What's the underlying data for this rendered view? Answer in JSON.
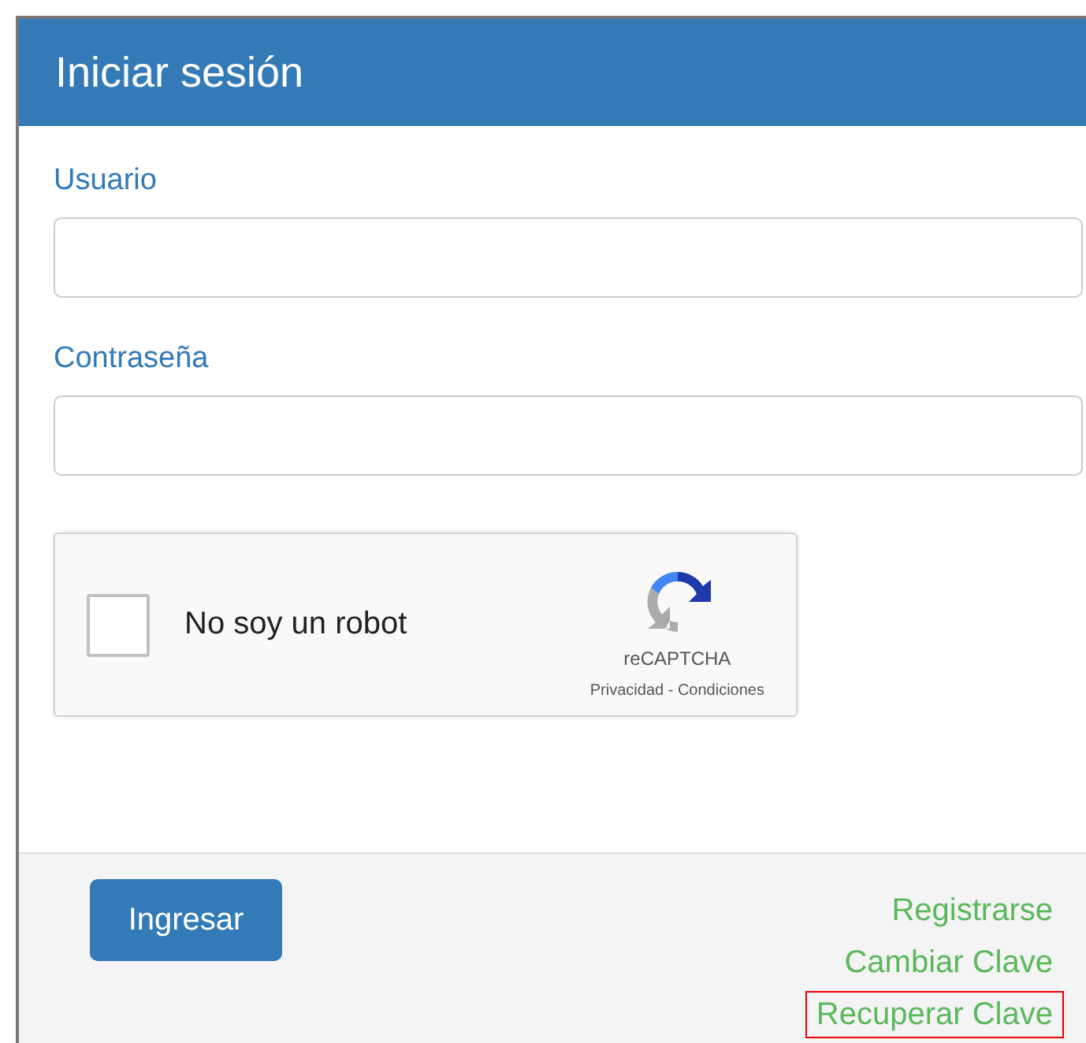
{
  "panel": {
    "title": "Iniciar sesión"
  },
  "fields": [
    {
      "label": "Usuario"
    },
    {
      "label": "Contraseña"
    }
  ],
  "captcha": {
    "label": "No soy un robot",
    "checked": false,
    "brand": "reCAPTCHA",
    "links": "Privacidad - Condiciones"
  },
  "submit": "Ingresar",
  "links": [
    {
      "label": "Registrarse",
      "highlighted": false
    },
    {
      "label": "Cambiar Clave",
      "highlighted": false
    },
    {
      "label": "Recuperar Clave",
      "highlighted": true
    }
  ]
}
